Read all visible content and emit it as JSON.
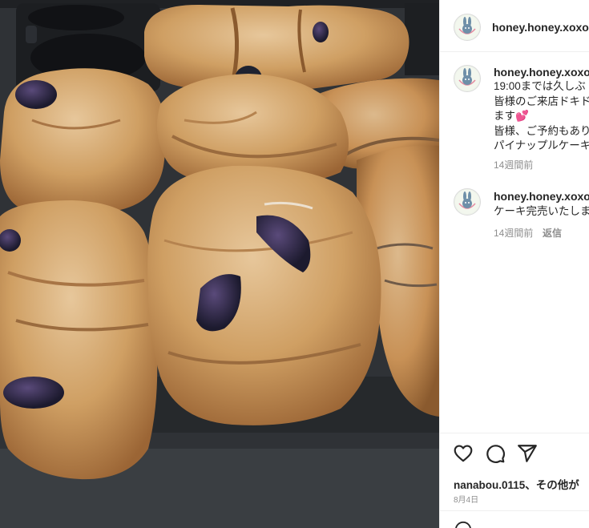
{
  "post": {
    "image_alt": "baked bread rolls with plums on a muffin tin"
  },
  "header": {
    "username": "honey.honey.xoxo"
  },
  "comments": [
    {
      "username": "honey.honey.xoxo",
      "lines": [
        "19:00までは久しぶ",
        "皆様のご来店ドキド",
        "ます💕",
        "皆様、ご予約もあり",
        "パイナップルケーキ"
      ],
      "time": "14週間前"
    },
    {
      "username": "honey.honey.xoxo",
      "lines": [
        "ケーキ完売いたしま"
      ],
      "time": "14週間前",
      "reply_label": "返信"
    }
  ],
  "actions": {
    "likes_text": "nanabou.0115、その他が",
    "date": "8月4日"
  },
  "colors": {
    "text": "#262626",
    "muted": "#8e8e8e",
    "border": "#efefef"
  }
}
